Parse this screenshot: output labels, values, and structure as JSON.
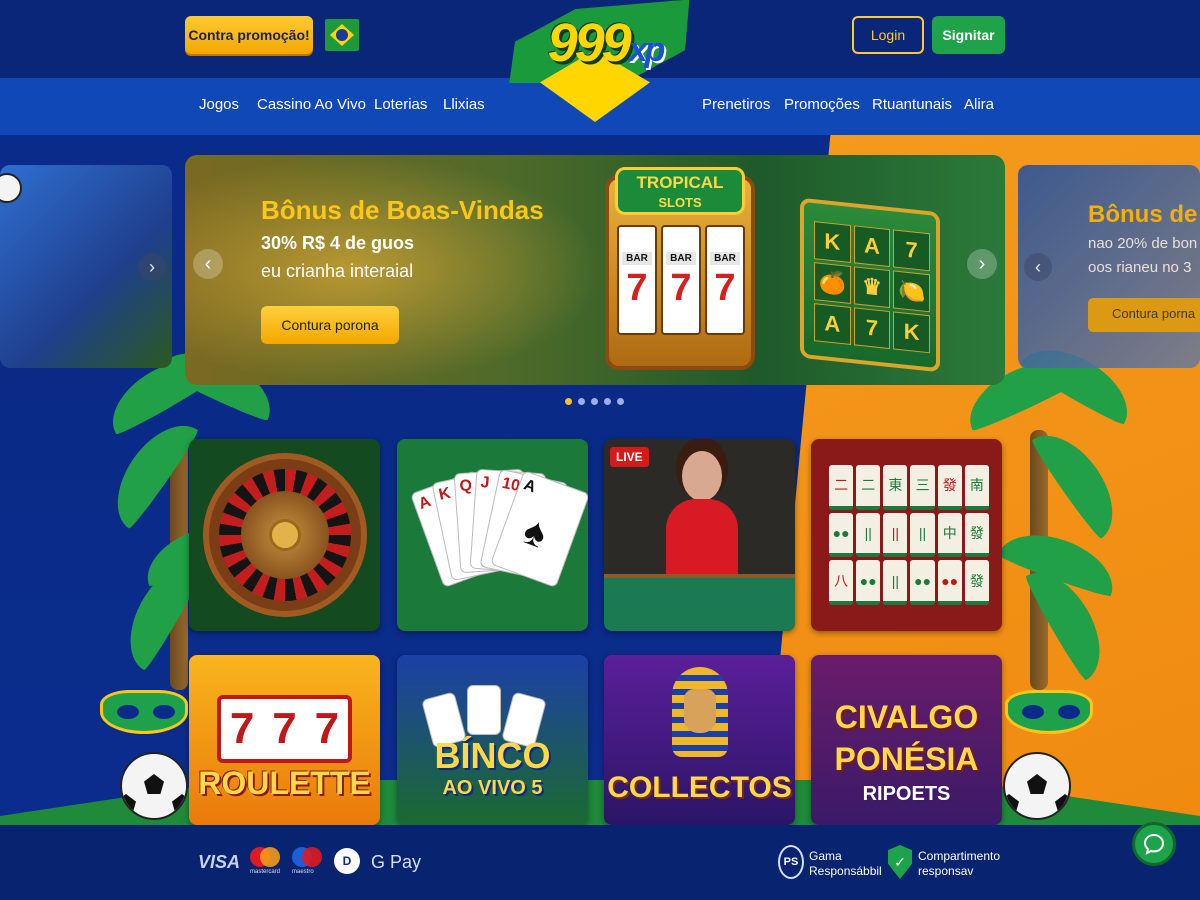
{
  "header": {
    "promo_button": "Contra promoção!",
    "logo_text": "999",
    "logo_suffix": "xp",
    "login_button": "Login",
    "signup_button": "Signitar"
  },
  "nav": {
    "items": [
      "Jogos",
      "Cassino Ao Vivo",
      "Loterias",
      "Llixias",
      "Prenetiros",
      "Promoções",
      "Rtuantunais",
      "Alira"
    ]
  },
  "hero": {
    "title": "Bônus de Boas-Vindas",
    "line1": "30% R$ 4 de guos",
    "line2": "eu crianha interaial",
    "cta": "Contura porona",
    "sign_line1": "TROPICAL",
    "sign_line2": "SLOTS",
    "reel_symbol": "7",
    "reel_bar": "BAR",
    "slot2_symbols": [
      "K",
      "A",
      "7",
      "🍊",
      "♛",
      "🍋",
      "A",
      "7",
      "K"
    ],
    "active_slide": 1,
    "slide_count": 5
  },
  "side_right": {
    "title": "Bônus de B",
    "line1": "nao 20% de bon",
    "line2": "oos rianeu no 3",
    "cta": "Contura porna"
  },
  "games": {
    "live_badge": "LIVE",
    "roulette_label": "ROULETTE",
    "bingo_label1": "BÍNCO",
    "bingo_label2": "AO VIVO 5",
    "collect_label": "COLLECTOS",
    "civ_label1": "CIVALGO",
    "civ_label2": "PONÉSIA",
    "civ_label3": "RIPOETS",
    "reel_symbols": [
      "7",
      "7",
      "7"
    ],
    "card_ranks": [
      "A",
      "K",
      "Q",
      "J",
      "10",
      "A"
    ],
    "card_spade": "♠",
    "mahjong": [
      "二",
      "二",
      "東",
      "三",
      "發",
      "南",
      "●●",
      "||",
      "||",
      "||",
      "中",
      "發",
      "八",
      "●●",
      "||",
      "●●",
      "●●",
      "發"
    ]
  },
  "footer": {
    "visa": "VISA",
    "mastercard_caption": "mastercard",
    "maestro_caption": "maestro",
    "diners": "D",
    "gpay": "G Pay",
    "ps_badge": "PS",
    "responsible_line1": "Gama",
    "responsible_line2": "Responsábbil",
    "shield_line1": "Compartimento",
    "shield_line2": "responsav"
  },
  "icons": {
    "flag": "brazil-flag-icon",
    "chat": "chat-icon",
    "prev": "chevron-left-icon",
    "next": "chevron-right-icon"
  },
  "colors": {
    "primary_blue": "#0b2a8a",
    "nav_blue": "#1148b8",
    "accent_yellow": "#ffc61a",
    "accent_green": "#1fa34a",
    "accent_orange": "#f49a1d"
  }
}
